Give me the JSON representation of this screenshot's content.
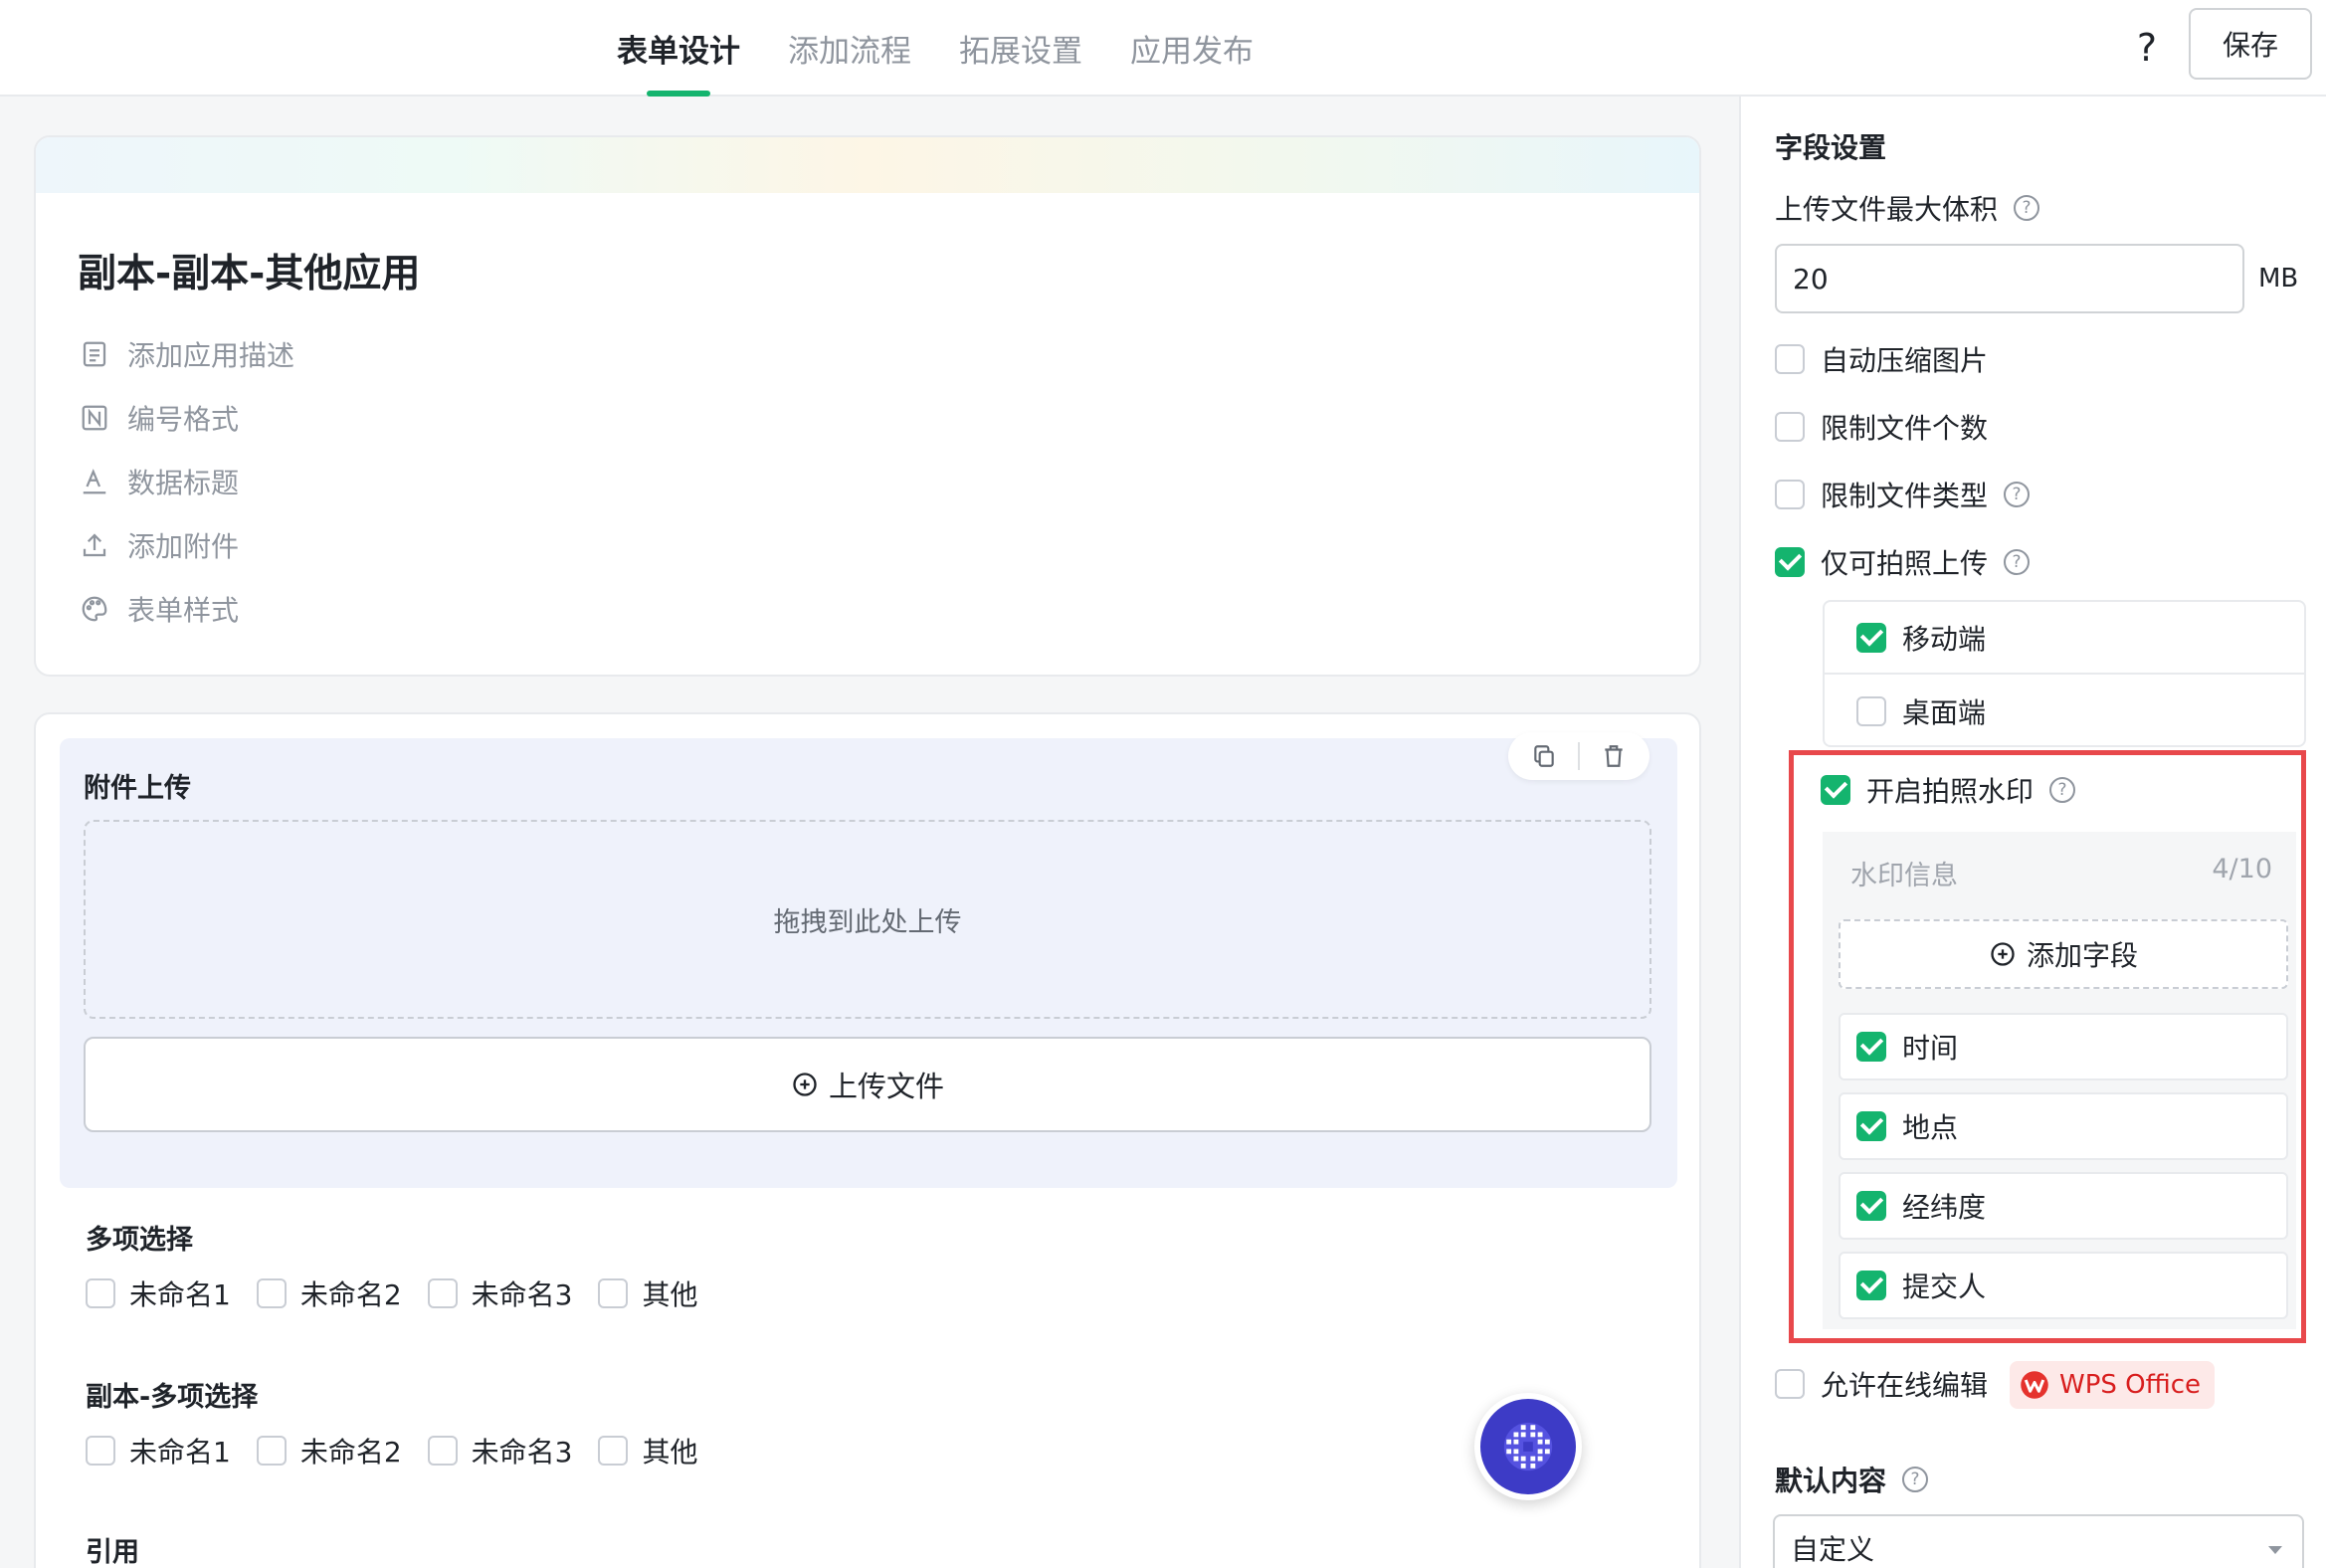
{
  "topbar": {
    "tabs": [
      {
        "label": "表单设计",
        "active": true
      },
      {
        "label": "添加流程",
        "active": false
      },
      {
        "label": "拓展设置",
        "active": false
      },
      {
        "label": "应用发布",
        "active": false
      }
    ],
    "help": "?",
    "save_label": "保存"
  },
  "app": {
    "title": "副本-副本-其他应用",
    "meta": [
      {
        "icon": "description-icon",
        "label": "添加应用描述"
      },
      {
        "icon": "number-format-icon",
        "label": "编号格式"
      },
      {
        "icon": "text-title-icon",
        "label": "数据标题"
      },
      {
        "icon": "upload-icon",
        "label": "添加附件"
      },
      {
        "icon": "palette-icon",
        "label": "表单样式"
      }
    ]
  },
  "form": {
    "attachment": {
      "label": "附件上传",
      "drop_text": "拖拽到此处上传",
      "upload_label": "上传文件"
    },
    "multi_select": {
      "label": "多项选择",
      "options": [
        "未命名1",
        "未命名2",
        "未命名3",
        "其他"
      ]
    },
    "multi_select_copy": {
      "label": "副本-多项选择",
      "options": [
        "未命名1",
        "未命名2",
        "未命名3",
        "其他"
      ]
    },
    "reference": {
      "label": "引用"
    }
  },
  "panel": {
    "title": "字段设置",
    "max_size_label": "上传文件最大体积",
    "max_size_value": "20",
    "max_size_unit": "MB",
    "auto_compress": {
      "label": "自动压缩图片",
      "checked": false
    },
    "limit_count": {
      "label": "限制文件个数",
      "checked": false
    },
    "limit_type": {
      "label": "限制文件类型",
      "checked": false
    },
    "photo_only": {
      "label": "仅可拍照上传",
      "checked": true
    },
    "platforms": [
      {
        "label": "移动端",
        "checked": true
      },
      {
        "label": "桌面端",
        "checked": false
      }
    ],
    "watermark": {
      "label": "开启拍照水印",
      "checked": true,
      "info_label": "水印信息",
      "count": "4/10",
      "add_field_label": "添加字段",
      "fields": [
        {
          "label": "时间",
          "checked": true
        },
        {
          "label": "地点",
          "checked": true
        },
        {
          "label": "经纬度",
          "checked": true
        },
        {
          "label": "提交人",
          "checked": true
        }
      ]
    },
    "online_edit": {
      "label": "允许在线编辑",
      "checked": false
    },
    "wps_label": "WPS Office",
    "default_content_label": "默认内容",
    "default_content_value": "自定义"
  },
  "colors": {
    "accent": "#14b46e",
    "highlight": "#e8484b",
    "wps": "#d81e1e",
    "fab": "#3d3bc6"
  }
}
